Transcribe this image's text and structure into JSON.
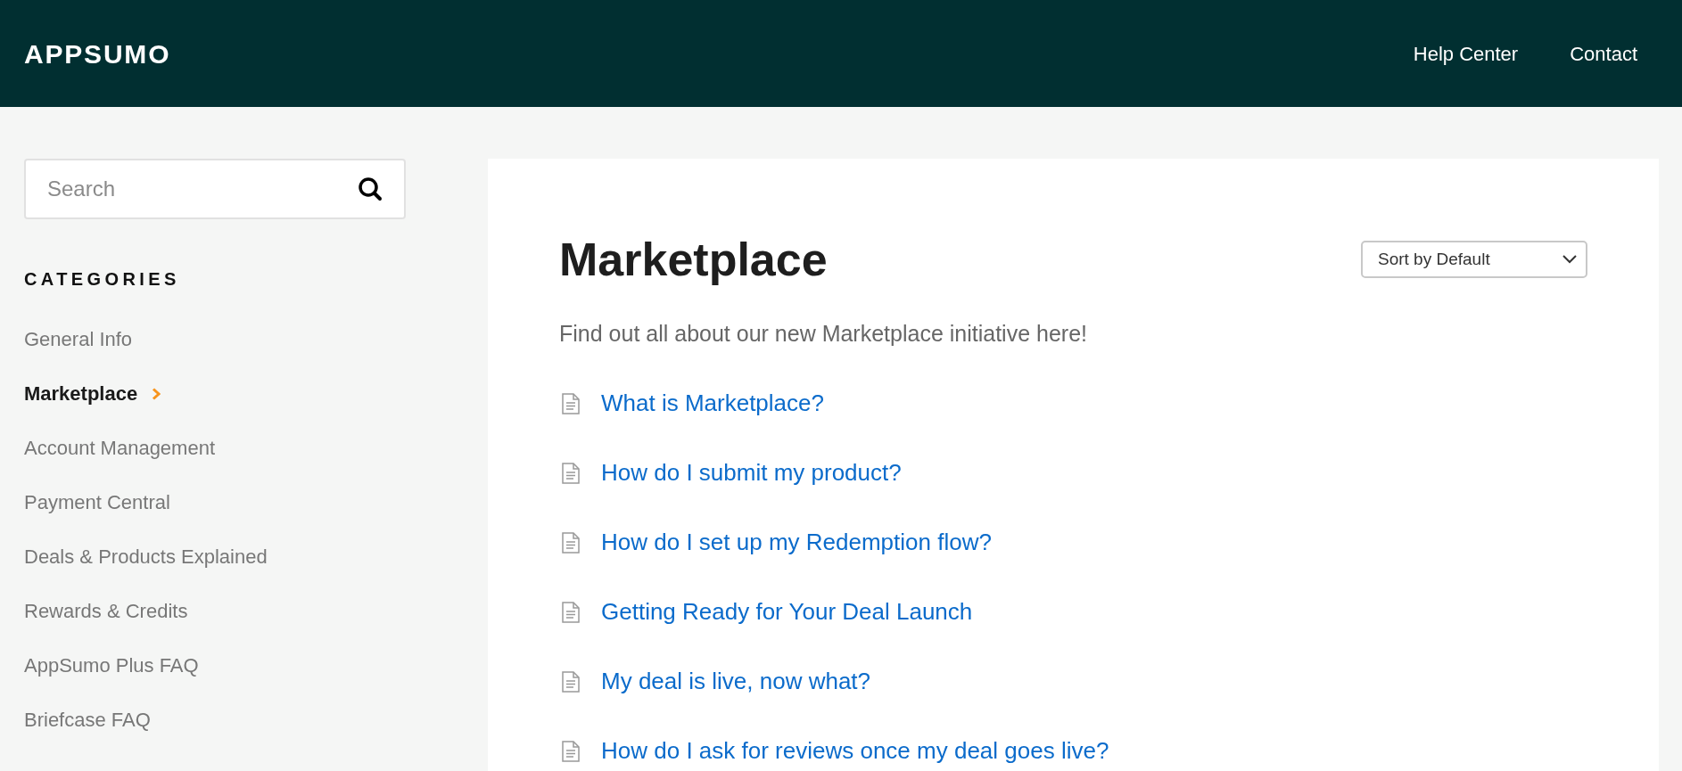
{
  "header": {
    "logo": "APPSUMO",
    "nav": [
      "Help Center",
      "Contact"
    ]
  },
  "sidebar": {
    "search": {
      "placeholder": "Search"
    },
    "heading": "CATEGORIES",
    "items": [
      {
        "label": "General Info",
        "selected": false
      },
      {
        "label": "Marketplace",
        "selected": true
      },
      {
        "label": "Account Management",
        "selected": false
      },
      {
        "label": "Payment Central",
        "selected": false
      },
      {
        "label": "Deals & Products Explained",
        "selected": false
      },
      {
        "label": "Rewards & Credits",
        "selected": false
      },
      {
        "label": "AppSumo Plus FAQ",
        "selected": false
      },
      {
        "label": "Briefcase FAQ",
        "selected": false
      }
    ]
  },
  "main": {
    "title": "Marketplace",
    "sort": {
      "value": "Sort by Default"
    },
    "description": "Find out all about our new Marketplace initiative here!",
    "articles": [
      "What is Marketplace?",
      "How do I submit my product?",
      "How do I set up my Redemption flow?",
      "Getting Ready for Your Deal Launch",
      "My deal is live, now what?",
      "How do I ask for reviews once my deal goes live?"
    ]
  }
}
